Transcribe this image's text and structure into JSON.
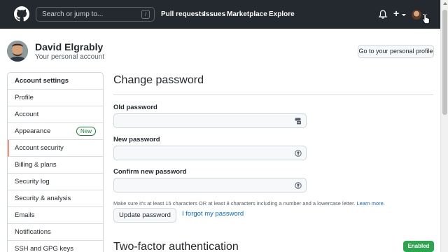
{
  "header": {
    "search_placeholder": "Search or jump to...",
    "search_shortcut": "/",
    "nav": [
      "Pull requests",
      "Issues",
      "Marketplace",
      "Explore"
    ],
    "plus_glyph": "+"
  },
  "profile": {
    "name": "David Elgrably",
    "subtitle": "Your personal account",
    "go_button": "Go to your personal profile"
  },
  "sidebar": {
    "items": [
      {
        "label": "Account settings"
      },
      {
        "label": "Profile"
      },
      {
        "label": "Account"
      },
      {
        "label": "Appearance",
        "badge": "New"
      },
      {
        "label": "Account security"
      },
      {
        "label": "Billing & plans"
      },
      {
        "label": "Security log"
      },
      {
        "label": "Security & analysis"
      },
      {
        "label": "Emails"
      },
      {
        "label": "Notifications"
      },
      {
        "label": "SSH and GPG keys"
      }
    ],
    "active_label": "Account security"
  },
  "main": {
    "title": "Change password",
    "fields": [
      {
        "label": "Old password",
        "value": ""
      },
      {
        "label": "New password",
        "value": ""
      },
      {
        "label": "Confirm new password",
        "value": ""
      }
    ],
    "hint": "Make sure it's at least 15 characters OR at least 8 characters including a number and a lowercase letter.",
    "hint_link": "Learn more.",
    "update_button": "Update password",
    "forgot_link": "I forgot my password",
    "tfa_title": "Two-factor authentication",
    "tfa_status": "Enabled"
  },
  "colors": {
    "header_bg": "#24292f",
    "link": "#0969da",
    "success": "#2da44e",
    "active_indicator": "#fd8c73"
  }
}
